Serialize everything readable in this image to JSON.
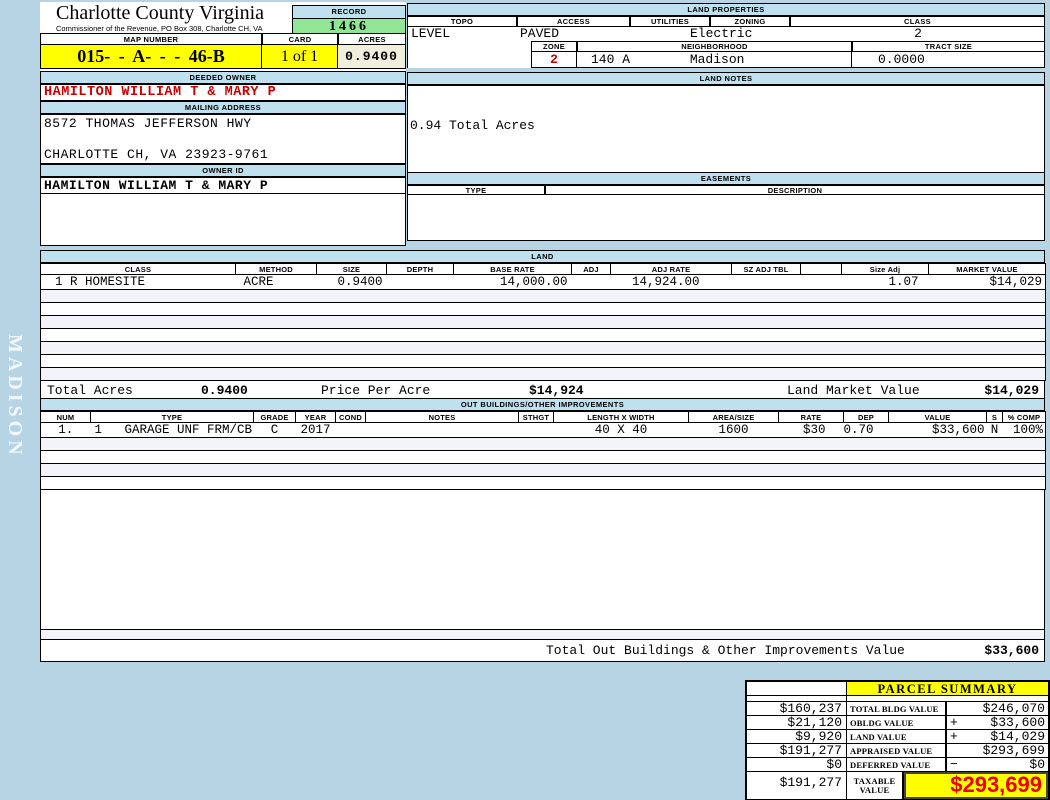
{
  "colors": {
    "page_blue": "#B7D4E4",
    "header_blue": "#BEE0EF",
    "highlight_yellow": "#FFFF00",
    "record_green": "#90E695",
    "acres_cream": "#F0EEDC",
    "owner_red": "#CC0000",
    "taxable_red": "#EE0000",
    "stripe_lavender": "#F3F4F9"
  },
  "sidebar": {
    "district": "MADISON"
  },
  "header": {
    "county_title": "Charlotte County Virginia",
    "county_subtitle": "Commissioner of the Revenue, PO Box 308, Charlotte CH, VA",
    "record_label": "RECORD",
    "record_value": "1466",
    "map_number_label": "MAP NUMBER",
    "map_number_value": "015- - A- - - 46-B",
    "card_label": "CARD",
    "card_value": "1 of 1",
    "acres_label": "ACRES",
    "acres_value": "0.9400"
  },
  "owner": {
    "deeded_owner_label": "DEEDED OWNER",
    "deeded_owner": "HAMILTON WILLIAM T & MARY P",
    "mailing_address_label": "MAILING ADDRESS",
    "address_line1": "8572 THOMAS JEFFERSON HWY",
    "address_line2": "CHARLOTTE CH, VA 23923-9761",
    "owner_id_label": "OWNER ID",
    "owner_id": "HAMILTON WILLIAM T & MARY P"
  },
  "land_properties": {
    "title": "LAND PROPERTIES",
    "topo_label": "TOPO",
    "access_label": "ACCESS",
    "utilities_label": "UTILITIES",
    "zoning_label": "ZONING",
    "class_label": "CLASS",
    "topo_value": "LEVEL",
    "access_value": "PAVED",
    "utilities_value": "Electric",
    "zoning_value": "",
    "class_value": "2",
    "zone_label": "ZONE",
    "zone_value": "2",
    "neighborhood_label": "NEIGHBORHOOD",
    "neighborhood_code": "140 A",
    "neighborhood_name": "Madison",
    "tract_size_label": "TRACT SIZE",
    "tract_size_value": "0.0000"
  },
  "land_notes": {
    "title": "LAND NOTES",
    "note": "0.94 Total Acres"
  },
  "easements": {
    "title": "EASEMENTS",
    "type_label": "TYPE",
    "description_label": "DESCRIPTION"
  },
  "land": {
    "title": "LAND",
    "columns": [
      "CLASS",
      "METHOD",
      "SIZE",
      "DEPTH",
      "BASE RATE",
      "ADJ",
      "ADJ RATE",
      "SZ ADJ TBL",
      "",
      "Size Adj",
      "MARKET VALUE"
    ],
    "rows": [
      [
        "1 R HOMESITE",
        "ACRE",
        "0.9400",
        "",
        "14,000.00",
        "",
        "14,924.00",
        "",
        "",
        "1.07",
        "$14,029"
      ]
    ],
    "totals": {
      "total_acres_label": "Total Acres",
      "total_acres": "0.9400",
      "price_per_acre_label": "Price Per Acre",
      "price_per_acre": "$14,924",
      "market_value_label": "Land Market Value",
      "market_value": "$14,029"
    }
  },
  "out_buildings": {
    "title": "OUT BUILDINGS/OTHER IMPROVEMENTS",
    "columns": [
      "NUM",
      "TYPE",
      "GRADE",
      "YEAR",
      "COND",
      "NOTES",
      "STHGT",
      "LENGTH X WIDTH",
      "AREA/SIZE",
      "RATE",
      "DEP",
      "VALUE",
      "S",
      "% COMP"
    ],
    "rows": [
      [
        "1.",
        "1   GARAGE UNF FRM/CB",
        "C",
        "2017",
        "",
        "",
        "",
        "40 X 40",
        "1600",
        "$30",
        "0.70",
        "$33,600",
        "N",
        "100%"
      ]
    ],
    "total_label": "Total Out Buildings & Other Improvements Value",
    "total_value": "$33,600"
  },
  "parcel_summary": {
    "title": "PARCEL SUMMARY",
    "rows": [
      {
        "prior": "$160,237",
        "label": "TOTAL BLDG VALUE",
        "op": "",
        "value": "$246,070"
      },
      {
        "prior": "$21,120",
        "label": "OBLDG VALUE",
        "op": "+",
        "value": "$33,600"
      },
      {
        "prior": "$9,920",
        "label": "LAND VALUE",
        "op": "+",
        "value": "$14,029"
      },
      {
        "prior": "$191,277",
        "label": "APPRAISED VALUE",
        "op": "",
        "value": "$293,699"
      },
      {
        "prior": "$0",
        "label": "DEFERRED VALUE",
        "op": "−",
        "value": "$0"
      }
    ],
    "taxable": {
      "prior": "$191,277",
      "label": "TAXABLE VALUE",
      "value": "$293,699"
    }
  }
}
